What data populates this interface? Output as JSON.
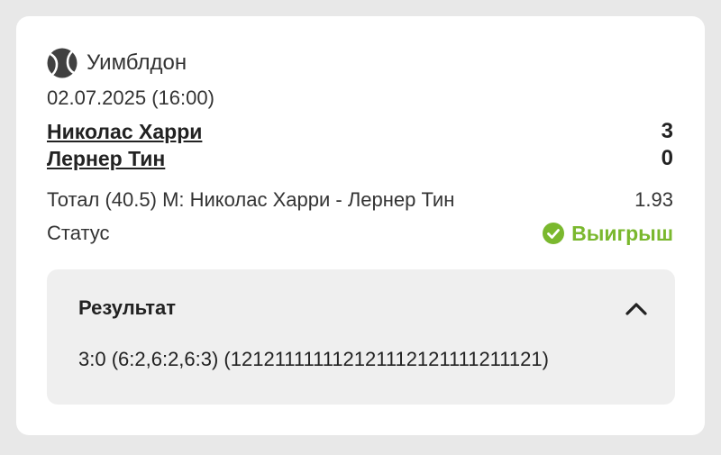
{
  "event": {
    "tournament": "Уимблдон",
    "sport_icon": "tennis-ball-icon",
    "datetime": "02.07.2025 (16:00)"
  },
  "players": [
    {
      "name": "Николас Харри",
      "score": "3"
    },
    {
      "name": "Лернер Тин",
      "score": "0"
    }
  ],
  "bet": {
    "market": "Тотал (40.5) М: Николас Харри - Лернер Тин",
    "odds": "1.93",
    "status_label": "Статус",
    "status_value": "Выигрыш",
    "status_color": "#7ab82e"
  },
  "result": {
    "title": "Результат",
    "value": "3:0 (6:2,6:2,6:3) (121211111112121112121111211121)",
    "expanded": true
  }
}
